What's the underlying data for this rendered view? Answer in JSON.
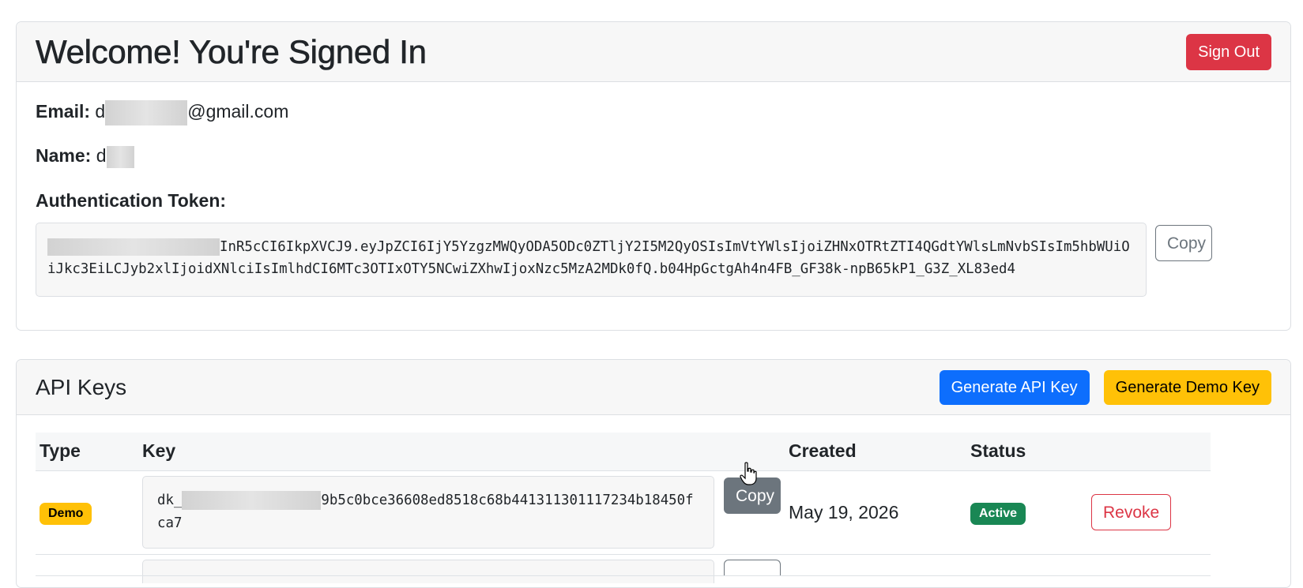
{
  "profile": {
    "title": "Welcome! You're Signed In",
    "sign_out_label": "Sign Out",
    "email_label": "Email:",
    "email_prefix": "d",
    "email_suffix": "@gmail.com",
    "name_label": "Name:",
    "name_prefix": "d",
    "token_label": "Authentication Token:",
    "token_visible": "InR5cCI6IkpXVCJ9.eyJpZCI6IjY5YzgzMWQyODA5ODc0ZTljY2I5M2QyOSIsImVtYWlsIjoiZHNxOTRtZTI4QGdtYWlsLmNvbSIsIm5hbWUiOiJkc3EiLCJyb2xlIjoidXNlciIsImlhdCI6MTc3OTIxOTY5NCwiZXhwIjoxNzc5MzA2MDk0fQ.b04HpGctgAh4n4FB_GF38k-npB65kP1_G3Z_XL83ed4",
    "copy_label": "Copy"
  },
  "api_keys": {
    "title": "API Keys",
    "generate_api_label": "Generate API Key",
    "generate_demo_label": "Generate Demo Key",
    "columns": [
      "Type",
      "Key",
      "Created",
      "Status",
      ""
    ],
    "rows": [
      {
        "type": "Demo",
        "key_prefix": "dk_",
        "key_visible": "9b5c0bce36608ed8518c68b441311301117234b18450fca7",
        "copy_label": "Copy",
        "created": "May 19, 2026",
        "status": "Active",
        "revoke_label": "Revoke"
      }
    ]
  },
  "colors": {
    "danger": "#dc3545",
    "primary": "#0d6efd",
    "warning": "#ffc107",
    "success": "#198754",
    "secondary": "#6c757d"
  }
}
